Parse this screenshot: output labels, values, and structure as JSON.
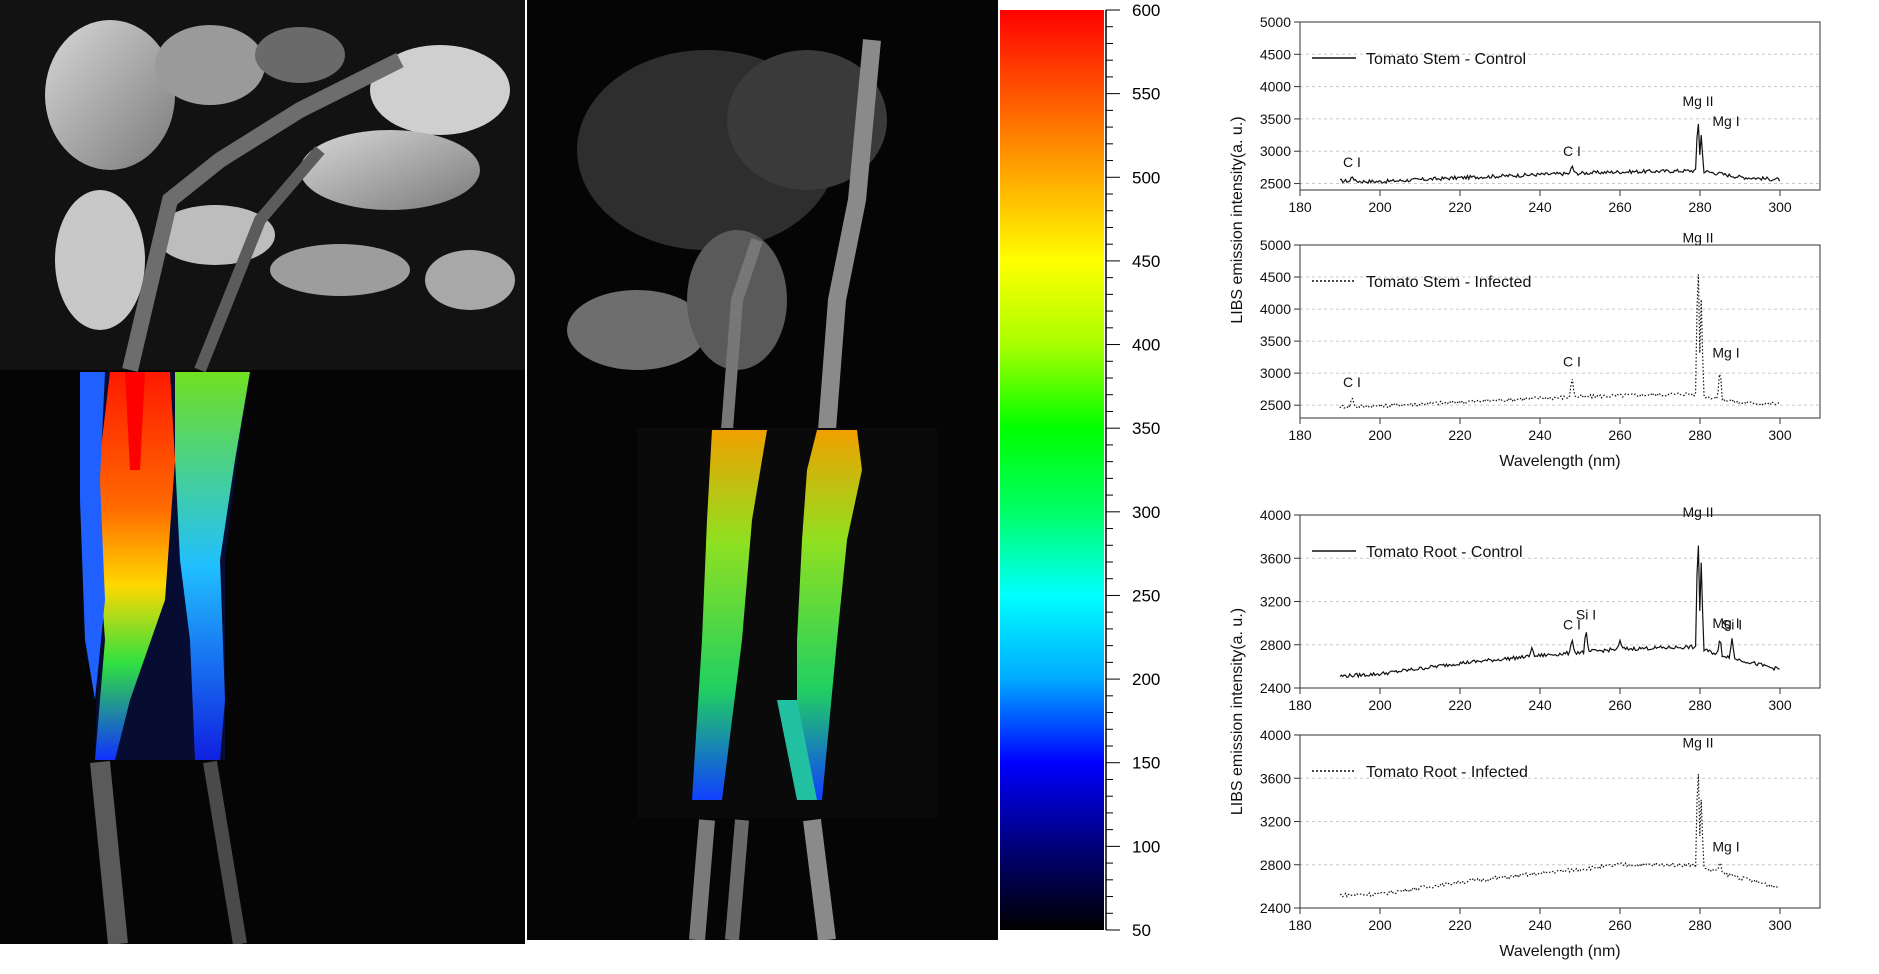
{
  "colorbar": {
    "ticks": [
      600,
      550,
      500,
      450,
      400,
      350,
      300,
      250,
      200,
      150,
      100,
      50
    ],
    "range": [
      50,
      600
    ],
    "gradient": [
      "#000000",
      "#00007a",
      "#0000ff",
      "#00aaff",
      "#00ffff",
      "#00ff66",
      "#00ff00",
      "#aaff00",
      "#ffff00",
      "#ffaa00",
      "#ff5500",
      "#ff0000"
    ]
  },
  "chart_data": [
    {
      "type": "line",
      "legend": "Tomato Stem - Control",
      "line_style": "solid",
      "x_range": [
        180,
        310
      ],
      "y_range": [
        2400,
        5000
      ],
      "x_ticks": [
        180,
        200,
        220,
        240,
        260,
        280,
        300
      ],
      "y_ticks": [
        2500,
        3000,
        3500,
        4000,
        4500,
        5000
      ],
      "baseline": [
        [
          190,
          2540
        ],
        [
          200,
          2530
        ],
        [
          220,
          2590
        ],
        [
          240,
          2640
        ],
        [
          260,
          2680
        ],
        [
          280,
          2700
        ],
        [
          290,
          2600
        ],
        [
          300,
          2560
        ]
      ],
      "peaks": [
        [
          193,
          2620
        ],
        [
          248,
          2790
        ],
        [
          279.5,
          3560
        ],
        [
          280.3,
          3250
        ],
        [
          285,
          2680
        ]
      ],
      "annotations": [
        {
          "text": "C I",
          "x": 193,
          "y": 2620
        },
        {
          "text": "C I",
          "x": 248,
          "y": 2790
        },
        {
          "text": "Mg II",
          "x": 279.5,
          "y": 3560
        },
        {
          "text": "Mg I",
          "x": 285,
          "y": 3250
        }
      ]
    },
    {
      "type": "line",
      "legend": "Tomato Stem - Infected",
      "line_style": "dotted",
      "x_range": [
        180,
        310
      ],
      "y_range": [
        2300,
        5000
      ],
      "x_ticks": [
        180,
        200,
        220,
        240,
        260,
        280,
        300
      ],
      "y_ticks": [
        2500,
        3000,
        3500,
        4000,
        4500,
        5000
      ],
      "xlabel": "Wavelength (nm)",
      "baseline": [
        [
          190,
          2480
        ],
        [
          200,
          2490
        ],
        [
          220,
          2550
        ],
        [
          240,
          2610
        ],
        [
          260,
          2650
        ],
        [
          278,
          2680
        ],
        [
          290,
          2540
        ],
        [
          300,
          2520
        ]
      ],
      "peaks": [
        [
          193,
          2640
        ],
        [
          248,
          2960
        ],
        [
          279.5,
          4900
        ],
        [
          280.3,
          4150
        ],
        [
          285,
          3100
        ]
      ],
      "annotations": [
        {
          "text": "C I",
          "x": 193,
          "y": 2640
        },
        {
          "text": "C I",
          "x": 248,
          "y": 2960
        },
        {
          "text": "Mg II",
          "x": 279.5,
          "y": 4900
        },
        {
          "text": "Mg I",
          "x": 285,
          "y": 3100
        }
      ]
    },
    {
      "type": "line",
      "legend": "Tomato Root - Control",
      "line_style": "solid",
      "x_range": [
        180,
        310
      ],
      "y_range": [
        2400,
        4000
      ],
      "x_ticks": [
        180,
        200,
        220,
        240,
        260,
        280,
        300
      ],
      "y_ticks": [
        2400,
        2800,
        3200,
        3600,
        4000
      ],
      "baseline": [
        [
          190,
          2510
        ],
        [
          200,
          2530
        ],
        [
          220,
          2630
        ],
        [
          240,
          2700
        ],
        [
          260,
          2760
        ],
        [
          278,
          2780
        ],
        [
          290,
          2660
        ],
        [
          300,
          2570
        ]
      ],
      "peaks": [
        [
          238,
          2780
        ],
        [
          248,
          2860
        ],
        [
          251.5,
          2950
        ],
        [
          260,
          2840
        ],
        [
          279.5,
          3900
        ],
        [
          280.3,
          3560
        ],
        [
          285,
          2870
        ],
        [
          288,
          2860
        ]
      ],
      "annotations": [
        {
          "text": "C I",
          "x": 248,
          "y": 2860
        },
        {
          "text": "Si I",
          "x": 251.5,
          "y": 2950
        },
        {
          "text": "Mg II",
          "x": 279.5,
          "y": 3900
        },
        {
          "text": "Mg I",
          "x": 285,
          "y": 2870
        },
        {
          "text": "Si I",
          "x": 288,
          "y": 2860
        }
      ]
    },
    {
      "type": "line",
      "legend": "Tomato Root - Infected",
      "line_style": "dotted",
      "x_range": [
        180,
        310
      ],
      "y_range": [
        2400,
        4000
      ],
      "x_ticks": [
        180,
        200,
        220,
        240,
        260,
        280,
        300
      ],
      "y_ticks": [
        2400,
        2800,
        3200,
        3600,
        4000
      ],
      "xlabel": "Wavelength (nm)",
      "baseline": [
        [
          190,
          2520
        ],
        [
          200,
          2530
        ],
        [
          220,
          2640
        ],
        [
          240,
          2720
        ],
        [
          260,
          2800
        ],
        [
          278,
          2800
        ],
        [
          290,
          2680
        ],
        [
          300,
          2590
        ]
      ],
      "peaks": [
        [
          279.5,
          3800
        ],
        [
          280.3,
          3400
        ],
        [
          285,
          2840
        ]
      ],
      "annotations": [
        {
          "text": "Mg II",
          "x": 279.5,
          "y": 3800
        },
        {
          "text": "Mg I",
          "x": 285,
          "y": 2840
        }
      ]
    }
  ],
  "shared_ylabel": "LIBS emission intensity(a. u.)"
}
